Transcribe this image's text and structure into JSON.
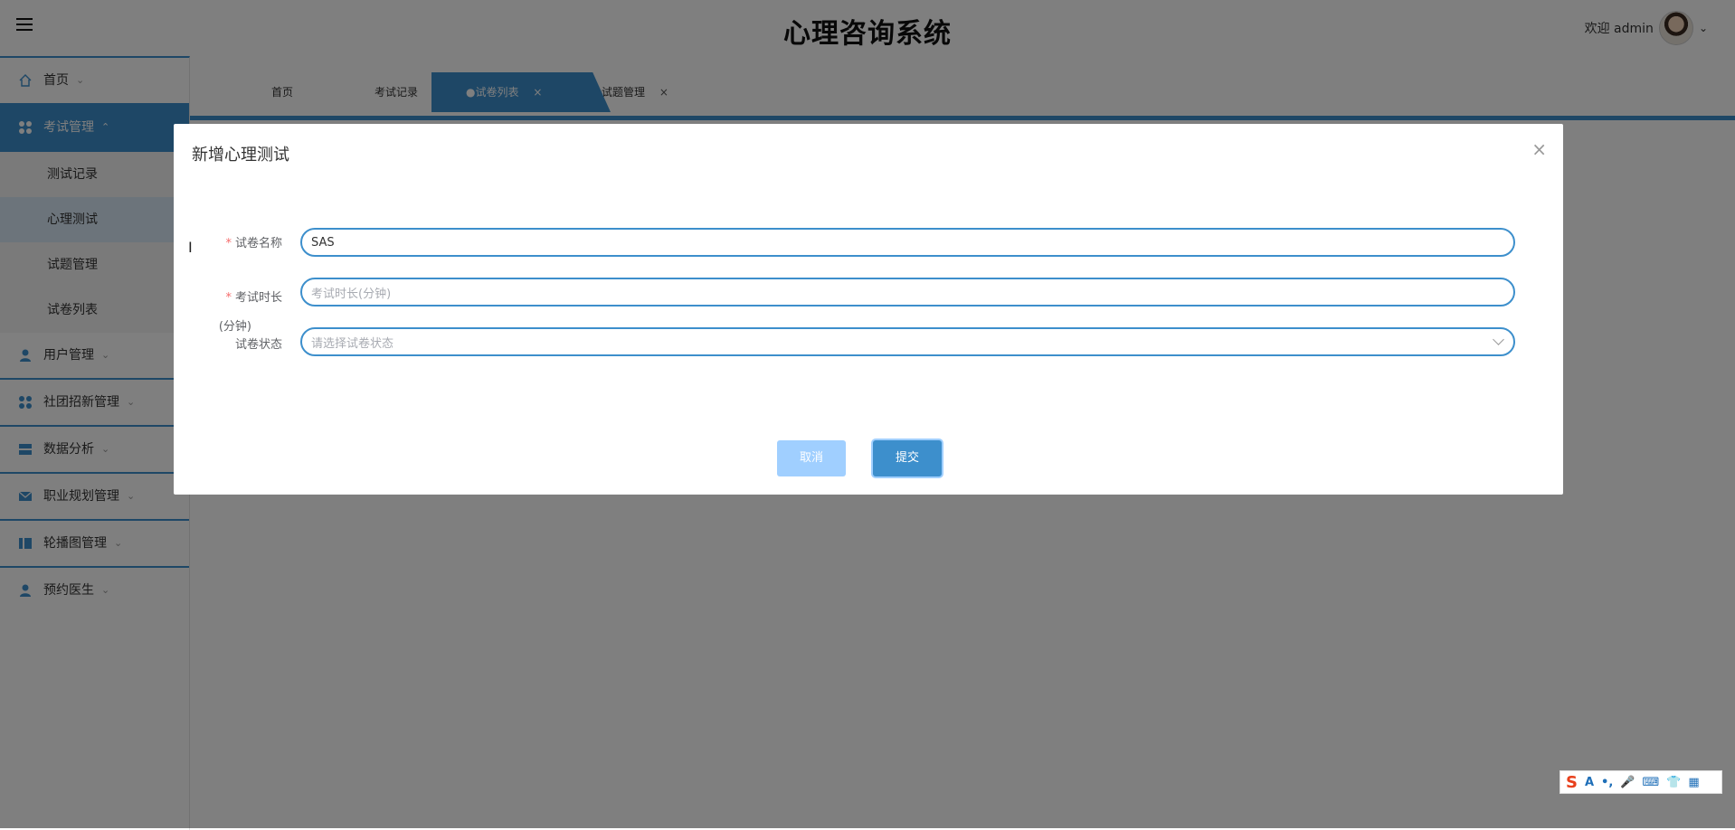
{
  "app": {
    "title": "心理咨询系统"
  },
  "user": {
    "greeting": "欢迎 admin"
  },
  "sidebar": {
    "items": [
      {
        "label": "首页",
        "icon": "home-icon"
      },
      {
        "label": "考试管理",
        "icon": "grid-icon",
        "active": true
      },
      {
        "label": "用户管理",
        "icon": "user-icon"
      },
      {
        "label": "社团招新管理",
        "icon": "grid-icon"
      },
      {
        "label": "数据分析",
        "icon": "list-icon"
      },
      {
        "label": "职业规划管理",
        "icon": "mail-icon"
      },
      {
        "label": "轮播图管理",
        "icon": "panel-icon"
      },
      {
        "label": "预约医生",
        "icon": "user-icon"
      }
    ],
    "subitems": [
      {
        "label": "测试记录"
      },
      {
        "label": "心理测试",
        "active": true
      },
      {
        "label": "试题管理"
      },
      {
        "label": "试卷列表"
      }
    ]
  },
  "tabs": [
    {
      "label": "首页"
    },
    {
      "label": "考试记录",
      "close": "×"
    },
    {
      "label": "●试卷列表",
      "close": "×",
      "active": true
    },
    {
      "label": "试题管理",
      "close": "×"
    }
  ],
  "dialog": {
    "title": "新增心理测试",
    "close": "×",
    "fields": {
      "name": {
        "label": "试卷名称",
        "required": "*",
        "value": "SAS"
      },
      "duration": {
        "label": "考试时长",
        "label2": "(分钟)",
        "required": "*",
        "placeholder": "考试时长(分钟)"
      },
      "status": {
        "label": "试卷状态",
        "placeholder": "请选择试卷状态"
      }
    },
    "cancel_label": "取消",
    "submit_label": "提交"
  },
  "ime": {
    "items": [
      "A",
      "•,",
      "🎤",
      "⌨",
      "👕",
      "▦"
    ]
  }
}
